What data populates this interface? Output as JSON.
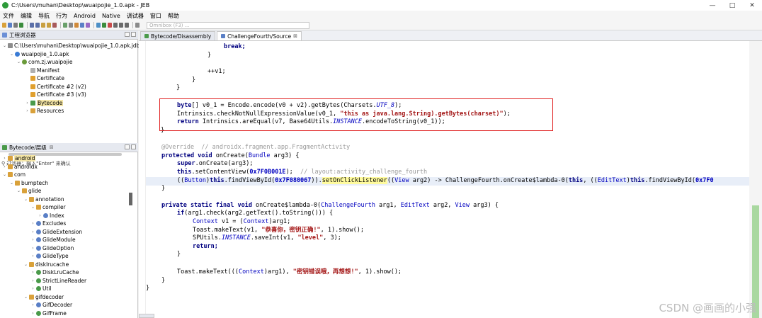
{
  "window": {
    "title": "C:\\Users\\muhan\\Desktop\\wuaipojie_1.0.apk - JEB",
    "controls": [
      "—",
      "□",
      "✕"
    ]
  },
  "menu": [
    "文件",
    "编辑",
    "导航",
    "行为",
    "Android",
    "Native",
    "调试器",
    "窗口",
    "帮助"
  ],
  "toolbar": {
    "omnibox_placeholder": "Omnibox (F3) ..."
  },
  "project_pane": {
    "tab_label": "工程浏览器",
    "tree": [
      {
        "label": "C:\\Users\\muhan\\Desktop\\wuaipojie_1.0.apk.jdb"
      },
      {
        "label": "wuaipojie_1.0.apk"
      },
      {
        "label": "com.zj.wuaipojie"
      },
      {
        "label": "Manifest"
      },
      {
        "label": "Certificate"
      },
      {
        "label": "Certificate #2 (v2)"
      },
      {
        "label": "Certificate #3 (v3)"
      },
      {
        "label": "Bytecode"
      },
      {
        "label": "Resources"
      }
    ],
    "filter_label": "过滤器：输入\"Enter\" 来确认"
  },
  "hierarchy_pane": {
    "tab_label": "Bytecode/层级",
    "tree": [
      {
        "label": "android"
      },
      {
        "label": "androidx"
      },
      {
        "label": "com"
      },
      {
        "label": "bumptech"
      },
      {
        "label": "glide"
      },
      {
        "label": "annotation"
      },
      {
        "label": "compiler"
      },
      {
        "label": "Index"
      },
      {
        "label": "Excludes"
      },
      {
        "label": "GlideExtension"
      },
      {
        "label": "GlideModule"
      },
      {
        "label": "GlideOption"
      },
      {
        "label": "GlideType"
      },
      {
        "label": "disklrucache"
      },
      {
        "label": "DiskLruCache"
      },
      {
        "label": "StrictLineReader"
      },
      {
        "label": "Util"
      },
      {
        "label": "gifdecoder"
      },
      {
        "label": "GifDecoder"
      },
      {
        "label": "GifFrame"
      }
    ]
  },
  "editor_tabs": [
    {
      "label": "Bytecode/Disassembly"
    },
    {
      "label": "ChallengeFourth/Source"
    }
  ],
  "code": {
    "l01": "break;",
    "l02": "}",
    "l03": "++v1;",
    "l04": "}",
    "l05": "}",
    "l06a": "byte",
    "l06b": "[] v0_1 = Encode.encode(v0 + v2).getBytes(Charsets.",
    "l06c": "UTF_8",
    "l06d": ");",
    "l07a": "Intrinsics.checkNotNullExpressionValue(v0_1, ",
    "l07b": "\"this as java.lang.String).getBytes(charset)\"",
    "l07c": ");",
    "l08a": "return",
    "l08b": " Intrinsics.areEqual(v7, Base64Utils.",
    "l08c": "INSTANCE",
    "l08d": ".encodeToString(v0_1));",
    "l09": "}",
    "l10a": "@Override",
    "l10b": "  // androidx.fragment.app.FragmentActivity",
    "l11a": "protected void",
    "l11b": " onCreate(",
    "l11c": "Bundle",
    "l11d": " arg3) {",
    "l12a": "super",
    "l12b": ".onCreate(arg3);",
    "l13a": "this",
    "l13b": ".setContentView(",
    "l13c": "0x7F0B001E",
    "l13d": ");  ",
    "l13e": "// layout:activity_challenge_fourth",
    "l14a": "((",
    "l14b": "Button",
    "l14c": ")",
    "l14d": "this",
    "l14e": ".findViewById(",
    "l14f": "0x7F080067",
    "l14g": ")).",
    "l14h": "setOnClickListener",
    "l14i": "((",
    "l14j": "View",
    "l14k": " arg2) -> ",
    "l14l": "ChallengeFourth.onCreate$lambda-0(",
    "l14m": "this",
    "l14n": ", ((",
    "l14o": "EditText",
    "l14p": ")",
    "l14q": "this",
    "l14r": ".findViewById(",
    "l14s": "0x7F0",
    "l15": "}",
    "l16a": "private static final void",
    "l16b": " onCreate$lambda-0(",
    "l16c": "ChallengeFourth",
    "l16d": " arg1, ",
    "l16e": "EditText",
    "l16f": " arg2, ",
    "l16g": "View",
    "l16h": " arg3) {",
    "l17a": "if",
    "l17b": "(arg1.check(arg2.getText().toString())) {",
    "l18a": "Context",
    "l18b": " v1 = (",
    "l18c": "Context",
    "l18d": ")arg1;",
    "l19a": "Toast.makeText(v1, ",
    "l19b": "\"恭喜你，密钥正确!\"",
    "l19c": ", 1).show();",
    "l20a": "SPUtils.",
    "l20b": "INSTANCE",
    "l20c": ".saveInt(v1, ",
    "l20d": "\"level\"",
    "l20e": ", 3);",
    "l21": "return;",
    "l22": "}",
    "l23a": "Toast.makeText(((",
    "l23b": "Context",
    "l23c": ")arg1), ",
    "l23d": "\"密钥错误哦，再想想!\"",
    "l23e": ", 1).show();",
    "l24": "}",
    "l25": "}"
  },
  "watermark": "CSDN @画画的小强",
  "colors": {
    "selection": "#f5e6a6",
    "highlight_box": "#e02020",
    "keyword": "#000080",
    "string": "#a31515"
  }
}
